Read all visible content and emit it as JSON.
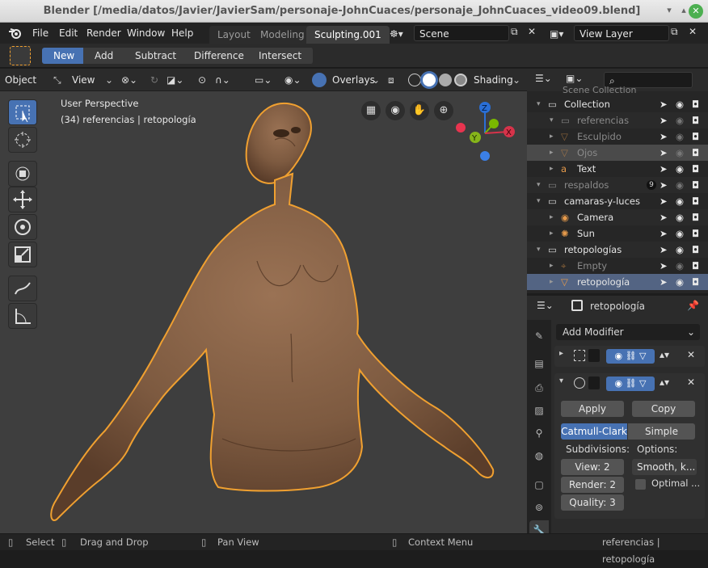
{
  "window": {
    "title": "Blender [/media/datos/Javier/JavierSam/personaje-JohnCuaces/personaje_JohnCuaces_video09.blend]"
  },
  "menu": {
    "items": [
      "File",
      "Edit",
      "Render",
      "Window",
      "Help"
    ]
  },
  "workspaces": [
    {
      "label": "Layout"
    },
    {
      "label": "Modeling"
    },
    {
      "label": "Sculpting.001",
      "active": true
    }
  ],
  "scene": {
    "name": "Scene"
  },
  "view_layer": {
    "name": "View Layer"
  },
  "tool_settings": {
    "modes": [
      {
        "label": "New",
        "active": true
      },
      {
        "label": "Add"
      },
      {
        "label": "Subtract"
      },
      {
        "label": "Difference"
      },
      {
        "label": "Intersect"
      }
    ]
  },
  "viewport_header": {
    "mode": "Object",
    "view": "View",
    "overlays": "Overlays",
    "shading": "Shading"
  },
  "viewport": {
    "perspective": "User Perspective",
    "object_info": "(34) referencias | retopología",
    "gizmo": {
      "z": "Z",
      "y": "Y",
      "x": "X"
    }
  },
  "outliner": {
    "search_placeholder": "",
    "top_partial": "Scene Collection",
    "rows": [
      {
        "label": "Collection",
        "indent": 1,
        "kind": "collection",
        "dim": false
      },
      {
        "label": "referencias",
        "indent": 2,
        "kind": "collection",
        "dim": true
      },
      {
        "label": "Esculpido",
        "indent": 2,
        "kind": "mesh",
        "dim": true
      },
      {
        "label": "Ojos",
        "indent": 2,
        "kind": "mesh",
        "dim": true,
        "selected": true
      },
      {
        "label": "Text",
        "indent": 2,
        "kind": "text",
        "dim": false
      },
      {
        "label": "respaldos",
        "indent": 1,
        "kind": "collection",
        "dim": true,
        "badge": "9"
      },
      {
        "label": "camaras-y-luces",
        "indent": 1,
        "kind": "collection",
        "dim": false
      },
      {
        "label": "Camera",
        "indent": 2,
        "kind": "camera",
        "dim": false
      },
      {
        "label": "Sun",
        "indent": 2,
        "kind": "light",
        "dim": false
      },
      {
        "label": "retopologías",
        "indent": 1,
        "kind": "collection",
        "dim": false
      },
      {
        "label": "Empty",
        "indent": 2,
        "kind": "empty",
        "dim": true
      },
      {
        "label": "retopología",
        "indent": 2,
        "kind": "mesh",
        "dim": false,
        "active": true
      }
    ]
  },
  "properties": {
    "object_name": "retopología",
    "add_modifier": "Add Modifier",
    "apply": "Apply",
    "copy": "Copy",
    "subdiv_type": {
      "catmull": "Catmull-Clark",
      "simple": "Simple"
    },
    "subdivisions_label": "Subdivisions:",
    "options_label": "Options:",
    "view": "View:  2",
    "render": "Render:  2",
    "quality": "Quality:  3",
    "smooth": "Smooth, k...",
    "optimal": "Optimal ..."
  },
  "status": {
    "select": "Select",
    "drag": "Drag and Drop",
    "pan": "Pan View",
    "context": "Context Menu",
    "right": "referencias | retopología"
  },
  "colors": {
    "accent": "#4772b3",
    "active_row": "#536483",
    "selection_outline": "#f0a030",
    "skin": "#8a6548"
  }
}
